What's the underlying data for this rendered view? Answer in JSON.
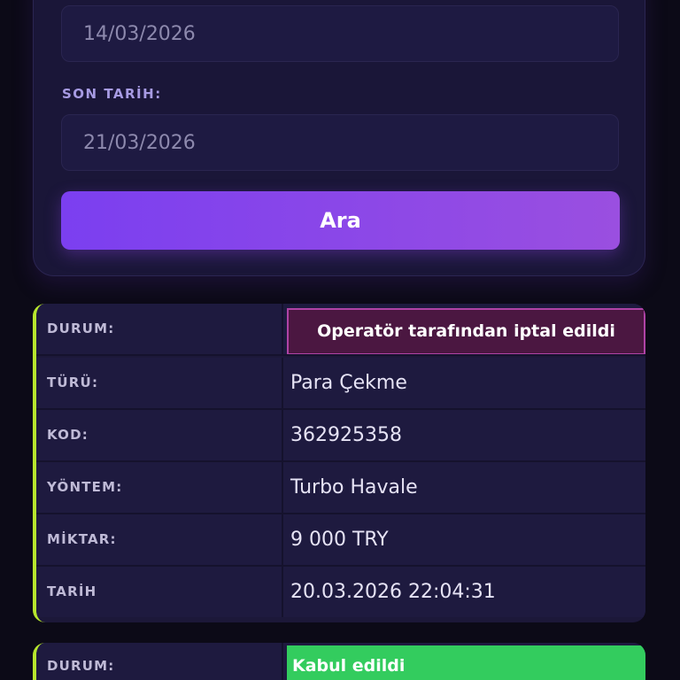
{
  "filter": {
    "start_date": "14/03/2026",
    "end_date_label": "SON TARİH:",
    "end_date": "21/03/2026",
    "search_label": "Ara"
  },
  "transactions": [
    {
      "status_label": "DURUM:",
      "status": "Operatör tarafından iptal edildi",
      "type_label": "TÜRÜ:",
      "type": "Para Çekme",
      "code_label": "KOD:",
      "code": "362925358",
      "method_label": "YÖNTEM:",
      "method": "Turbo Havale",
      "amount_label": "MİKTAR:",
      "amount": "9 000 TRY",
      "date_label": "TARİH",
      "date": "20.03.2026 22:04:31"
    },
    {
      "status_label": "DURUM:",
      "status": "Kabul edildi"
    }
  ],
  "colors": {
    "accent_purple": "#7b3ff0",
    "card_border_accent": "#b7e62d",
    "status_cancel_bg": "#4b1741",
    "status_cancel_border": "#b043a6",
    "status_accept_bg": "#33cc5e"
  }
}
